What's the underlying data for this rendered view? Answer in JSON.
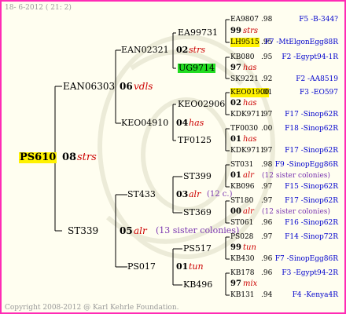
{
  "header": {
    "date_text": "18-  6-2012 ( 21:  2)"
  },
  "footer": {
    "copyright": "Copyright 2008-2012 @ Karl Kehrle Foundation."
  },
  "colors": {
    "frame_border": "#ff2bb5",
    "background": "#fffef0",
    "highlight_yellow": "#fff200",
    "highlight_green": "#22dd22",
    "link_blue": "#0000cc",
    "name_red": "#cc0000"
  },
  "gen1": {
    "name": "PS610",
    "num": "08",
    "tag": "strs"
  },
  "gen2": [
    {
      "name": "EAN06303",
      "num": "06",
      "tag": "vdls"
    },
    {
      "name": "ST339",
      "num": "05",
      "tag": "alr",
      "note": "(13 sister colonies)"
    }
  ],
  "gen3": [
    {
      "name": "EAN02321",
      "num": "02",
      "tag": "strs"
    },
    {
      "name": "KEO04910",
      "num": "04",
      "tag": "has"
    },
    {
      "name": "ST433",
      "num": "03",
      "tag": "alr",
      "note": "(12 c.)"
    },
    {
      "name": "PS017",
      "num": "01",
      "tag": "tun"
    }
  ],
  "gen4": [
    {
      "name": "EA99731",
      "num": "02",
      "tag": "strs"
    },
    {
      "name": "UG9714",
      "num": "",
      "tag": ""
    },
    {
      "name": "KEO02906",
      "num": "",
      "tag": ""
    },
    {
      "name": "TF0125",
      "num": "",
      "tag": ""
    },
    {
      "name": "ST399",
      "num": "",
      "tag": ""
    },
    {
      "name": "ST369",
      "num": "",
      "tag": ""
    },
    {
      "name": "PS517",
      "num": "",
      "tag": ""
    },
    {
      "name": "KB496",
      "num": "",
      "tag": ""
    }
  ],
  "gen5": [
    {
      "name": "EA9807",
      "year": ".98",
      "link": "F5 -B-344?"
    },
    {
      "num": "99",
      "tag": "strs"
    },
    {
      "name": "LH9515",
      "year": ".95",
      "link": "F7 -MtElgonEgg88R"
    },
    {
      "name": "KB080",
      "year": ".95",
      "link": "F2 -Egypt94-1R"
    },
    {
      "num": "97",
      "tag": "has"
    },
    {
      "name": "SK9221",
      "year": ".92",
      "link": "F2 -AA8519"
    },
    {
      "name": "KEO01900",
      "year": ".01",
      "link": "F3 -EO597"
    },
    {
      "num": "02",
      "tag": "has"
    },
    {
      "name": "KDK9711",
      "year": ".97",
      "link": "F17 -Sinop62R"
    },
    {
      "name": "TF0030",
      "year": ".00",
      "link": "F18 -Sinop62R"
    },
    {
      "num": "01",
      "tag": "has"
    },
    {
      "name": "KDK9711",
      "year": ".97",
      "link": "F17 -Sinop62R"
    },
    {
      "name": "ST031",
      "year": ".98",
      "link": "F9 -SinopEgg86R"
    },
    {
      "num": "01",
      "tag": "alr",
      "note": "(12 sister colonies)"
    },
    {
      "name": "KB096",
      "year": ".97",
      "link": "F15 -Sinop62R"
    },
    {
      "name": "ST180",
      "year": ".97",
      "link": "F17 -Sinop62R"
    },
    {
      "num": "00",
      "tag": "alr",
      "note": "(12 sister colonies)"
    },
    {
      "name": "ST061",
      "year": ".96",
      "link": "F16 -Sinop62R"
    },
    {
      "name": "PS028",
      "year": ".97",
      "link": "F14 -Sinop72R"
    },
    {
      "num": "99",
      "tag": "tun"
    },
    {
      "name": "KB430",
      "year": ".96",
      "link": "F7 -SinopEgg86R"
    },
    {
      "name": "KB178",
      "year": ".96",
      "link": "F3 -Egypt94-2R"
    },
    {
      "num": "97",
      "tag": "mix"
    },
    {
      "name": "KB131",
      "year": ".94",
      "link": "F4 -Kenya4R"
    }
  ]
}
